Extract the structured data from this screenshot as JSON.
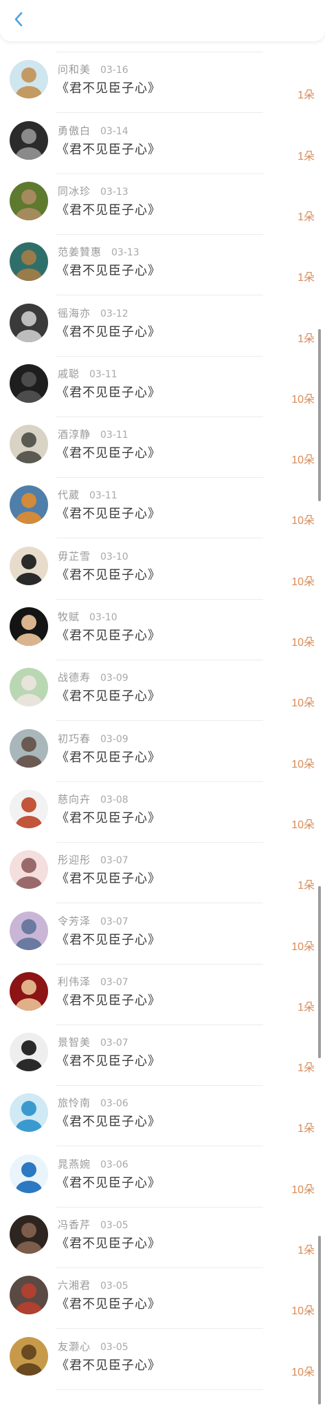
{
  "header": {
    "back_icon": "chevron-left-icon",
    "accent": "#4aa3df"
  },
  "items": [
    {
      "name": "",
      "date": "",
      "title": "《君不见臣子心》",
      "amount": "1朵",
      "avatar": {
        "bg": "#e8e4dc",
        "fg": "#b6aa96"
      }
    },
    {
      "name": "问和美",
      "date": "03-16",
      "title": "《君不见臣子心》",
      "amount": "1朵",
      "avatar": {
        "bg": "#cfe6ef",
        "fg": "#c49a63"
      }
    },
    {
      "name": "勇傲白",
      "date": "03-14",
      "title": "《君不见臣子心》",
      "amount": "1朵",
      "avatar": {
        "bg": "#2b2b2b",
        "fg": "#8a8a8a"
      }
    },
    {
      "name": "同冰珍",
      "date": "03-13",
      "title": "《君不见臣子心》",
      "amount": "1朵",
      "avatar": {
        "bg": "#5d7a2f",
        "fg": "#a58a5e"
      }
    },
    {
      "name": "范姜贊惠",
      "date": "03-13",
      "title": "《君不见臣子心》",
      "amount": "1朵",
      "avatar": {
        "bg": "#2f6f6a",
        "fg": "#9a7b4a"
      }
    },
    {
      "name": "徭海亦",
      "date": "03-12",
      "title": "《君不见臣子心》",
      "amount": "1朵",
      "avatar": {
        "bg": "#3a3a3a",
        "fg": "#bdbdbd"
      }
    },
    {
      "name": "戚聪",
      "date": "03-11",
      "title": "《君不见臣子心》",
      "amount": "10朵",
      "avatar": {
        "bg": "#1e1e1e",
        "fg": "#4c4c4c"
      }
    },
    {
      "name": "酒淳静",
      "date": "03-11",
      "title": "《君不见臣子心》",
      "amount": "10朵",
      "avatar": {
        "bg": "#d8d3c4",
        "fg": "#5a5a52"
      }
    },
    {
      "name": "代葳",
      "date": "03-11",
      "title": "《君不见臣子心》",
      "amount": "10朵",
      "avatar": {
        "bg": "#4f7fa8",
        "fg": "#d28a3b"
      }
    },
    {
      "name": "毋芷雪",
      "date": "03-10",
      "title": "《君不见臣子心》",
      "amount": "10朵",
      "avatar": {
        "bg": "#e7dccb",
        "fg": "#2a2a2a"
      }
    },
    {
      "name": "牧赋",
      "date": "03-10",
      "title": "《君不见臣子心》",
      "amount": "10朵",
      "avatar": {
        "bg": "#141414",
        "fg": "#d9b48f"
      }
    },
    {
      "name": "战德寿",
      "date": "03-09",
      "title": "《君不见臣子心》",
      "amount": "10朵",
      "avatar": {
        "bg": "#b9d7b3",
        "fg": "#e9e4db"
      }
    },
    {
      "name": "初巧春",
      "date": "03-09",
      "title": "《君不见臣子心》",
      "amount": "10朵",
      "avatar": {
        "bg": "#a9b7ba",
        "fg": "#6b5a52"
      }
    },
    {
      "name": "慈向卉",
      "date": "03-08",
      "title": "《君不见臣子心》",
      "amount": "10朵",
      "avatar": {
        "bg": "#f2f2f2",
        "fg": "#c2553a"
      }
    },
    {
      "name": "彤迎彤",
      "date": "03-07",
      "title": "《君不见臣子心》",
      "amount": "1朵",
      "avatar": {
        "bg": "#f4dede",
        "fg": "#9a6a6a"
      }
    },
    {
      "name": "令芳泽",
      "date": "03-07",
      "title": "《君不见臣子心》",
      "amount": "10朵",
      "avatar": {
        "bg": "#c9b6d6",
        "fg": "#6a7aa0"
      }
    },
    {
      "name": "利伟泽",
      "date": "03-07",
      "title": "《君不见臣子心》",
      "amount": "1朵",
      "avatar": {
        "bg": "#8c1414",
        "fg": "#e1b089"
      }
    },
    {
      "name": "景智美",
      "date": "03-07",
      "title": "《君不见臣子心》",
      "amount": "1朵",
      "avatar": {
        "bg": "#eeeeee",
        "fg": "#2a2a2a"
      }
    },
    {
      "name": "旅怜南",
      "date": "03-06",
      "title": "《君不见臣子心》",
      "amount": "1朵",
      "avatar": {
        "bg": "#cfe9f5",
        "fg": "#3a9ad0"
      }
    },
    {
      "name": "晁燕婉",
      "date": "03-06",
      "title": "《君不见臣子心》",
      "amount": "10朵",
      "avatar": {
        "bg": "#e9f4fb",
        "fg": "#2c78c2"
      }
    },
    {
      "name": "冯香芹",
      "date": "03-05",
      "title": "《君不见臣子心》",
      "amount": "1朵",
      "avatar": {
        "bg": "#2e2420",
        "fg": "#7c5c4a"
      }
    },
    {
      "name": "六湘君",
      "date": "03-05",
      "title": "《君不见臣子心》",
      "amount": "10朵",
      "avatar": {
        "bg": "#5b4a44",
        "fg": "#b0402f"
      }
    },
    {
      "name": "友灏心",
      "date": "03-05",
      "title": "《君不见臣子心》",
      "amount": "10朵",
      "avatar": {
        "bg": "#c79a4a",
        "fg": "#6a4a20"
      }
    }
  ]
}
